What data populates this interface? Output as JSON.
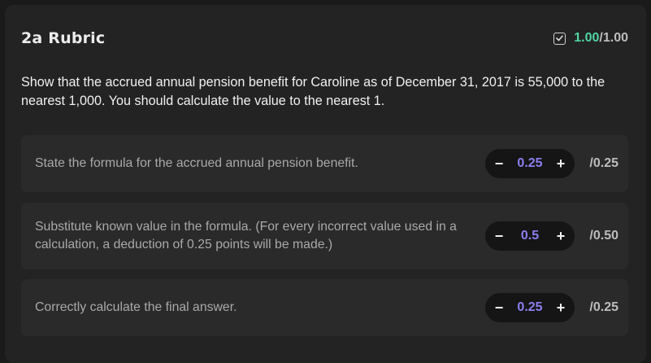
{
  "rubric": {
    "title": "2a Rubric",
    "score_awarded": "1.00",
    "score_max": "/1.00",
    "score_icon": "checkbox-checked-icon"
  },
  "question": "Show that the accrued annual pension benefit for Caroline as of December 31, 2017 is 55,000 to the nearest 1,000. You should calculate the value to the nearest 1.",
  "criteria": [
    {
      "text": "State the formula for the accrued annual pension benefit.",
      "value": "0.25",
      "max": "/0.25",
      "minus": "−",
      "plus": "+"
    },
    {
      "text": "Substitute known value in the formula. (For every incorrect value used in a calculation, a deduction of 0.25 points will be made.)",
      "value": "0.5",
      "max": "/0.50",
      "minus": "−",
      "plus": "+"
    },
    {
      "text": "Correctly calculate the final answer.",
      "value": "0.25",
      "max": "/0.25",
      "minus": "−",
      "plus": "+"
    }
  ],
  "colors": {
    "awarded": "#4fd6a3",
    "stepper_value": "#8b7ff0"
  }
}
